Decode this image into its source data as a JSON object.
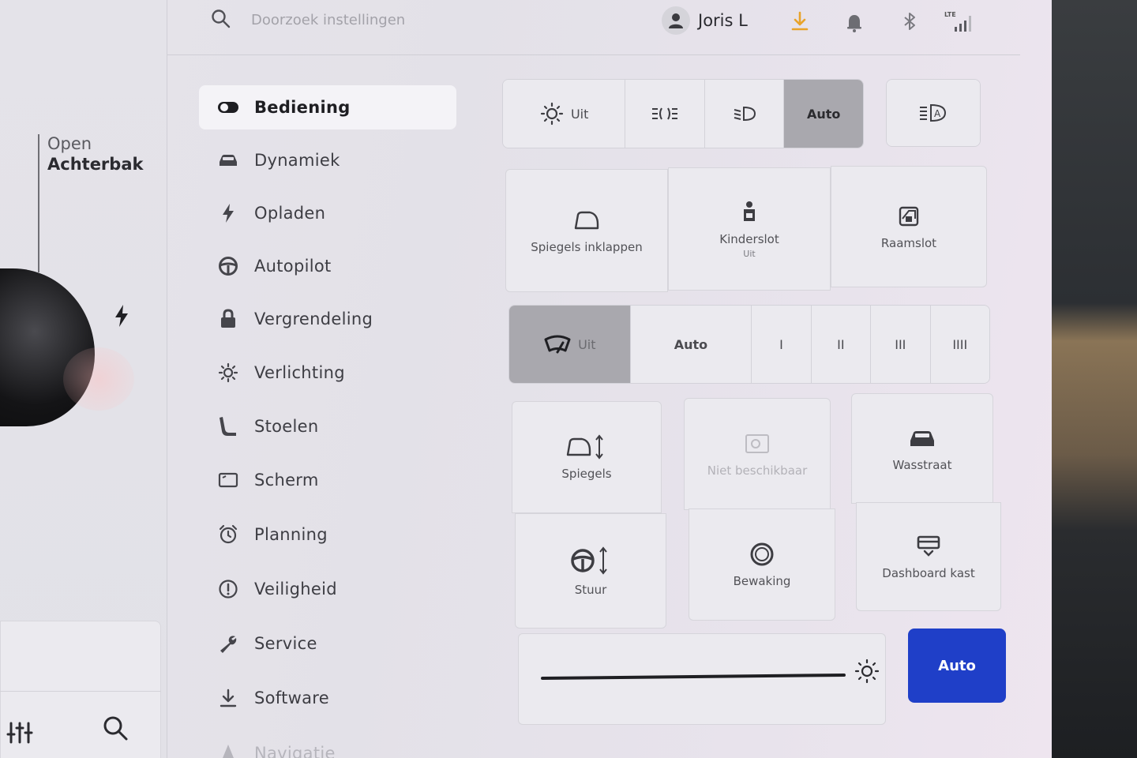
{
  "header": {
    "search_placeholder": "Doorzoek instellingen",
    "user_name": "Joris L",
    "network_label": "LTE"
  },
  "car_panel": {
    "trunk_open": "Open",
    "trunk_label": "Achterbak"
  },
  "menu": {
    "items": [
      {
        "label": "Bediening",
        "icon": "toggle-icon",
        "active": true
      },
      {
        "label": "Dynamiek",
        "icon": "car-icon"
      },
      {
        "label": "Opladen",
        "icon": "bolt-icon"
      },
      {
        "label": "Autopilot",
        "icon": "steering-wheel-icon"
      },
      {
        "label": "Vergrendeling",
        "icon": "lock-icon"
      },
      {
        "label": "Verlichting",
        "icon": "sun-icon"
      },
      {
        "label": "Stoelen",
        "icon": "seat-icon"
      },
      {
        "label": "Scherm",
        "icon": "display-icon"
      },
      {
        "label": "Planning",
        "icon": "alarm-clock-icon"
      },
      {
        "label": "Veiligheid",
        "icon": "alert-circle-icon"
      },
      {
        "label": "Service",
        "icon": "wrench-icon"
      },
      {
        "label": "Software",
        "icon": "download-icon"
      },
      {
        "label": "Navigatie",
        "icon": "navigation-icon"
      }
    ]
  },
  "lights": {
    "options": [
      "Uit",
      "",
      "",
      "Auto"
    ],
    "selected": "Auto"
  },
  "quick_controls": {
    "mirrors_fold": "Spiegels inklappen",
    "child_lock": "Kinderslot",
    "child_lock_state": "Uit",
    "window_lock": "Raamslot"
  },
  "wipers": {
    "options": [
      "Uit",
      "Auto",
      "I",
      "II",
      "III",
      "IIII"
    ],
    "selected": "Uit"
  },
  "adjust_cards": {
    "mirrors": "Spiegels",
    "unavailable": "Niet beschikbaar",
    "car_wash": "Wasstraat",
    "steering": "Stuur",
    "sentry": "Bewaking",
    "glovebox": "Dashboard kast"
  },
  "brightness": {
    "auto_label": "Auto",
    "level": 0.85
  },
  "colors": {
    "accent_blue": "#1f3fc8",
    "download_orange": "#e8a32a",
    "selected_gray": "#a9a8ae"
  }
}
